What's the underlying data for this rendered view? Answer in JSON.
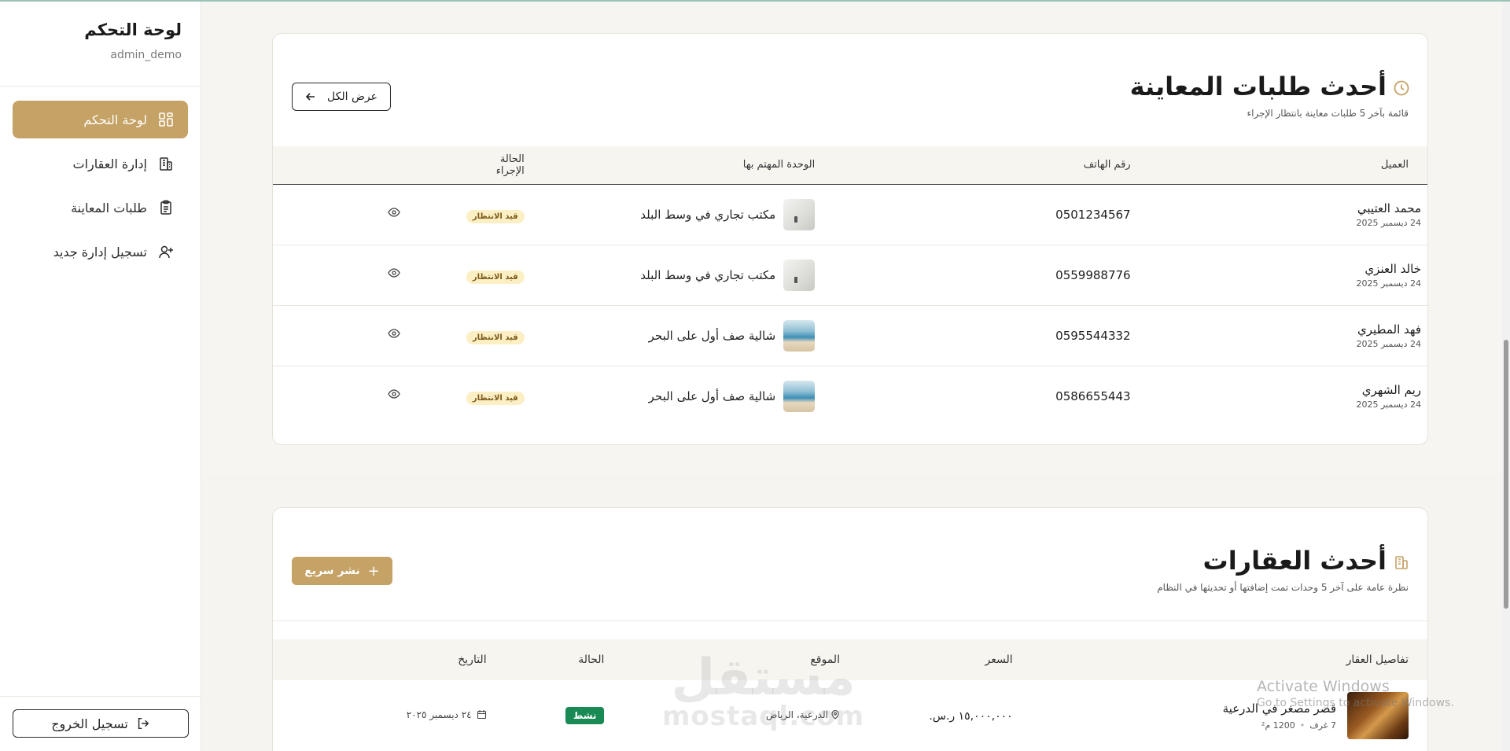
{
  "sidebar": {
    "title": "لوحة التحكم",
    "user": "admin_demo",
    "items": [
      {
        "label": "لوحة التحكم",
        "icon": "dashboard-icon",
        "active": true
      },
      {
        "label": "إدارة العقارات",
        "icon": "building-icon",
        "active": false
      },
      {
        "label": "طلبات المعاينة",
        "icon": "clipboard-icon",
        "active": false
      },
      {
        "label": "تسجيل إدارة جديد",
        "icon": "user-plus-icon",
        "active": false
      }
    ],
    "logout_label": "تسجيل الخروج"
  },
  "inspections": {
    "title": "أحدث طلبات المعاينة",
    "subtitle": "قائمة بآخر 5 طلبات معاينة بانتظار الإجراء",
    "view_all": "عرض الكل",
    "columns": {
      "client": "العميل",
      "phone": "رقم الهاتف",
      "unit": "الوحدة المهتم بها",
      "status": "الحالة",
      "action": "الإجراء"
    },
    "rows": [
      {
        "name": "محمد العتيبي",
        "date": "24 ديسمبر 2025",
        "phone": "0501234567",
        "unit": "مكتب تجاري في وسط البلد",
        "thumb": "office",
        "status": "قيد الانتظار"
      },
      {
        "name": "خالد العنزي",
        "date": "24 ديسمبر 2025",
        "phone": "0559988776",
        "unit": "مكتب تجاري في وسط البلد",
        "thumb": "office",
        "status": "قيد الانتظار"
      },
      {
        "name": "فهد المطيري",
        "date": "24 ديسمبر 2025",
        "phone": "0595544332",
        "unit": "شالية صف أول على البحر",
        "thumb": "beach",
        "status": "قيد الانتظار"
      },
      {
        "name": "ريم الشهري",
        "date": "24 ديسمبر 2025",
        "phone": "0586655443",
        "unit": "شالية صف أول على البحر",
        "thumb": "beach",
        "status": "قيد الانتظار"
      }
    ]
  },
  "properties": {
    "title": "أحدث العقارات",
    "subtitle": "نظرة عامة على آخر 5 وحدات تمت إضافتها أو تحديثها في النظام",
    "quick_publish": "نشر سريع",
    "columns": {
      "details": "تفاصيل العقار",
      "price": "السعر",
      "location": "الموقع",
      "status": "الحالة",
      "date": "التاريخ"
    },
    "rows": [
      {
        "name": "قصر مصغر في الدرعية",
        "rooms": "7 غرف",
        "area": "1200 م²",
        "price": "١٥,٠٠٠,٠٠٠ ر.س.",
        "location": "الدرعية، الرياض",
        "status": "نشط",
        "date": "٢٤ ديسمبر ٢٠٢٥"
      }
    ]
  },
  "overlay": {
    "watermark_ar": "مستقل",
    "watermark_en": "mostaql.com",
    "activate_title": "Activate Windows",
    "activate_sub": "Go to Settings to activate Windows."
  },
  "colors": {
    "accent": "#c5a265",
    "active_badge": "#1a8a54",
    "pending_badge_bg": "#fcefc4"
  }
}
